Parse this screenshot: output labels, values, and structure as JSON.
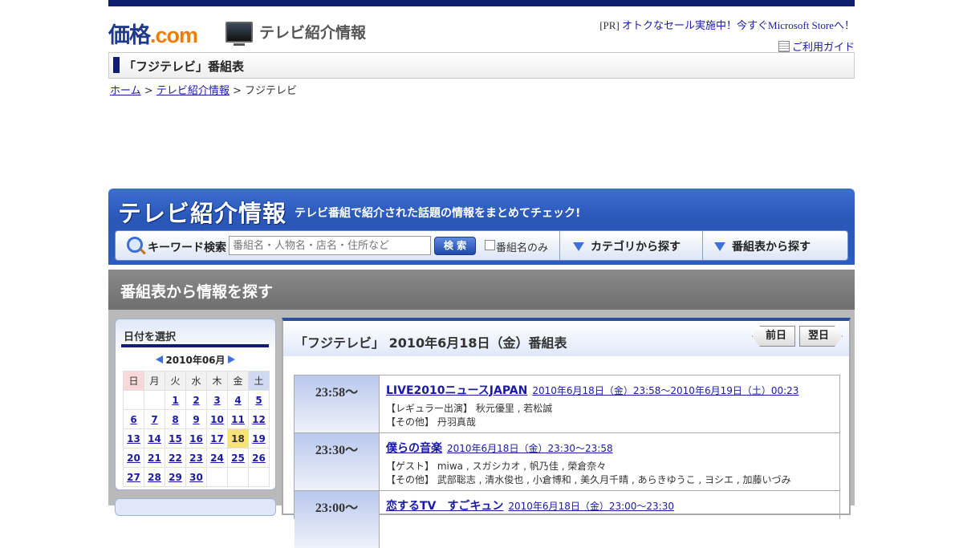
{
  "header": {
    "logo_main": "価格",
    "logo_dot": ".",
    "logo_com": "com",
    "section_name": "テレビ紹介情報",
    "pr_prefix": "[PR]",
    "pr_link": "オトクなセール実施中！今すぐMicrosoft Storeへ！",
    "guide_link": "ご利用ガイド"
  },
  "page_title": "「フジテレビ」番組表",
  "breadcrumb": {
    "home": "ホーム",
    "sep1": ">",
    "tv_info": "テレビ紹介情報",
    "sep2": ">",
    "current": "フジテレビ"
  },
  "banner": {
    "title": "テレビ紹介情報",
    "subtitle": "テレビ番組で紹介された話題の情報をまとめてチェック!",
    "search_label": "キーワード検索",
    "search_placeholder": "番組名・人物名・店名・住所など",
    "search_button": "検 索",
    "checkbox_label": "番組名のみ",
    "nav_category": "カテゴリから探す",
    "nav_schedule": "番組表から探す"
  },
  "section_title": "番組表から情報を探す",
  "calendar": {
    "heading": "日付を選択",
    "month": "2010年06月",
    "weekdays": [
      "日",
      "月",
      "火",
      "水",
      "木",
      "金",
      "土"
    ],
    "weeks": [
      [
        "",
        "",
        "1",
        "2",
        "3",
        "4",
        "5"
      ],
      [
        "6",
        "7",
        "8",
        "9",
        "10",
        "11",
        "12"
      ],
      [
        "13",
        "14",
        "15",
        "16",
        "17",
        "18",
        "19"
      ],
      [
        "20",
        "21",
        "22",
        "23",
        "24",
        "25",
        "26"
      ],
      [
        "27",
        "28",
        "29",
        "30",
        "",
        "",
        ""
      ]
    ],
    "selected_day": "18"
  },
  "schedule": {
    "heading": "「フジテレビ」 2010年6月18日（金）番組表",
    "prev_label": "前日",
    "next_label": "翌日",
    "programs": [
      {
        "time": "23:58～",
        "title": "LIVE2010ニュースJAPAN",
        "datetime": "2010年6月18日（金）23:58～2010年6月19日（土）00:23",
        "lines": [
          "【レギュラー出演】 秋元優里 , 若松誠",
          "【その他】 丹羽真哉"
        ]
      },
      {
        "time": "23:30～",
        "title": "僕らの音楽",
        "datetime": "2010年6月18日（金）23:30～23:58",
        "lines": [
          "【ゲスト】 miwa , スガシカオ , 帆乃佳 , 榮倉奈々",
          "【その他】 武部聡志 , 清水俊也 , 小倉博和 , 美久月千晴 , あらきゆうこ , ヨシエ , 加藤いづみ"
        ]
      },
      {
        "time": "23:00～",
        "title": "恋するTV　すごキュン",
        "datetime": "2010年6月18日（金）23:00～23:30",
        "lines": []
      }
    ]
  }
}
